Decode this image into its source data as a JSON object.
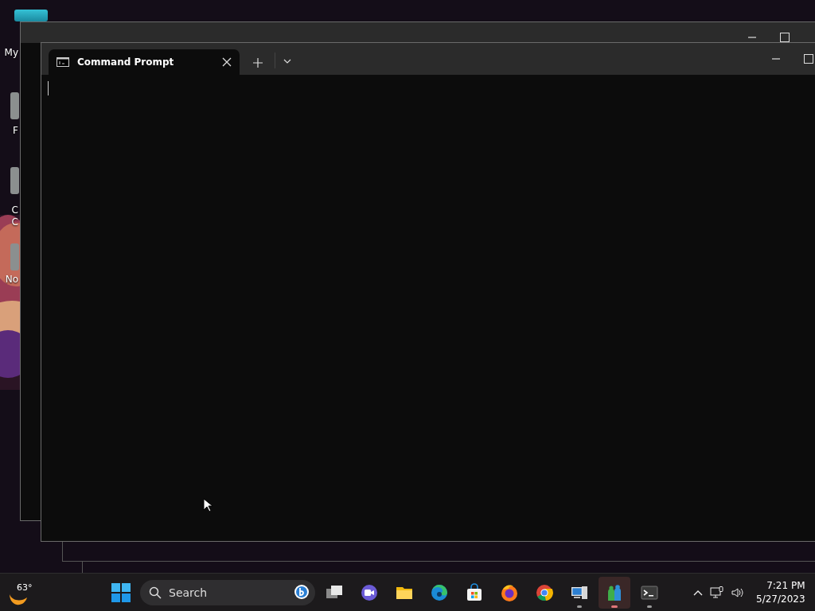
{
  "desktop": {
    "icons": [
      {
        "label": "My",
        "kind": "monitor"
      },
      {
        "label": "F",
        "kind": "app"
      },
      {
        "label": "C",
        "kind": "app"
      },
      {
        "label": "C",
        "kind": "none"
      },
      {
        "label": "No",
        "kind": "app"
      }
    ]
  },
  "window": {
    "tab": {
      "title": "Command Prompt",
      "selected": true
    },
    "cursor": true
  },
  "taskbar": {
    "weather": "63°",
    "search": {
      "placeholder": "Search"
    },
    "apps": [
      {
        "kind": "taskview",
        "running": false,
        "selected": false
      },
      {
        "kind": "chat",
        "running": false,
        "selected": false
      },
      {
        "kind": "folder",
        "running": false,
        "selected": false
      },
      {
        "kind": "edge",
        "running": false,
        "selected": false
      },
      {
        "kind": "store",
        "running": false,
        "selected": false
      },
      {
        "kind": "firefox",
        "running": false,
        "selected": false
      },
      {
        "kind": "chrome",
        "running": false,
        "selected": false
      },
      {
        "kind": "remote",
        "running": true,
        "selected": false
      },
      {
        "kind": "people",
        "running": true,
        "selected": true
      },
      {
        "kind": "terminal",
        "running": true,
        "selected": false
      }
    ],
    "time": "7:21 PM",
    "date": "5/27/2023"
  }
}
